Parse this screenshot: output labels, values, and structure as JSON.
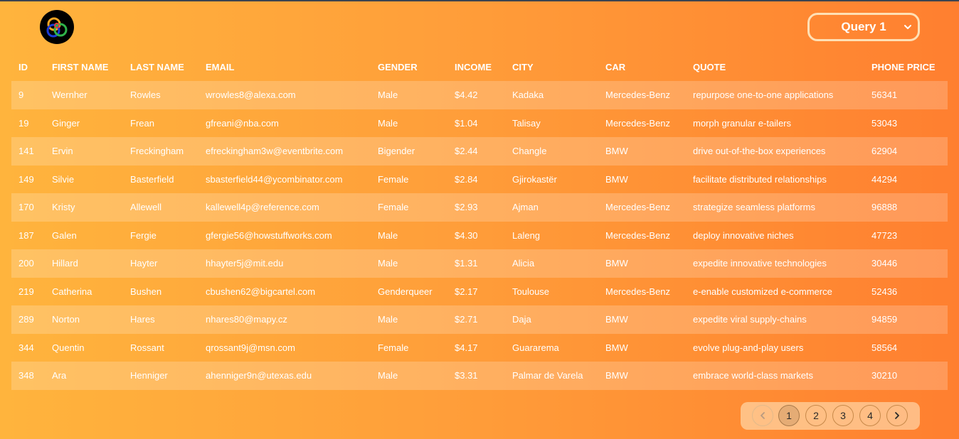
{
  "header": {
    "query_select": {
      "value": "Query 1"
    }
  },
  "table": {
    "columns": [
      "ID",
      "FIRST NAME",
      "LAST NAME",
      "EMAIL",
      "GENDER",
      "INCOME",
      "CITY",
      "CAR",
      "QUOTE",
      "PHONE PRICE"
    ],
    "rows": [
      [
        "9",
        "Wernher",
        "Rowles",
        "wrowles8@alexa.com",
        "Male",
        "$4.42",
        "Kadaka",
        "Mercedes-Benz",
        "repurpose one-to-one applications",
        "56341"
      ],
      [
        "19",
        "Ginger",
        "Frean",
        "gfreani@nba.com",
        "Male",
        "$1.04",
        "Talisay",
        "Mercedes-Benz",
        "morph granular e-tailers",
        "53043"
      ],
      [
        "141",
        "Ervin",
        "Freckingham",
        "efreckingham3w@eventbrite.com",
        "Bigender",
        "$2.44",
        "Changle",
        "BMW",
        "drive out-of-the-box experiences",
        "62904"
      ],
      [
        "149",
        "Silvie",
        "Basterfield",
        "sbasterfield44@ycombinator.com",
        "Female",
        "$2.84",
        "Gjirokastër",
        "BMW",
        "facilitate distributed relationships",
        "44294"
      ],
      [
        "170",
        "Kristy",
        "Allewell",
        "kallewell4p@reference.com",
        "Female",
        "$2.93",
        "Ajman",
        "Mercedes-Benz",
        "strategize seamless platforms",
        "96888"
      ],
      [
        "187",
        "Galen",
        "Fergie",
        "gfergie56@howstuffworks.com",
        "Male",
        "$4.30",
        "Laleng",
        "Mercedes-Benz",
        "deploy innovative niches",
        "47723"
      ],
      [
        "200",
        "Hillard",
        "Hayter",
        "hhayter5j@mit.edu",
        "Male",
        "$1.31",
        "Alicia",
        "BMW",
        "expedite innovative technologies",
        "30446"
      ],
      [
        "219",
        "Catherina",
        "Bushen",
        "cbushen62@bigcartel.com",
        "Genderqueer",
        "$2.17",
        "Toulouse",
        "Mercedes-Benz",
        "e-enable customized e-commerce",
        "52436"
      ],
      [
        "289",
        "Norton",
        "Hares",
        "nhares80@mapy.cz",
        "Male",
        "$2.71",
        "Daja",
        "BMW",
        "expedite viral supply-chains",
        "94859"
      ],
      [
        "344",
        "Quentin",
        "Rossant",
        "qrossant9j@msn.com",
        "Female",
        "$4.17",
        "Guararema",
        "BMW",
        "evolve plug-and-play users",
        "58564"
      ],
      [
        "348",
        "Ara",
        "Henniger",
        "ahenniger9n@utexas.edu",
        "Male",
        "$3.31",
        "Palmar de Varela",
        "BMW",
        "embrace world-class markets",
        "30210"
      ]
    ]
  },
  "pagination": {
    "prev_icon": "chevron-left-icon",
    "next_icon": "chevron-right-icon",
    "pages": [
      "1",
      "2",
      "3",
      "4"
    ],
    "active_page": "1"
  }
}
